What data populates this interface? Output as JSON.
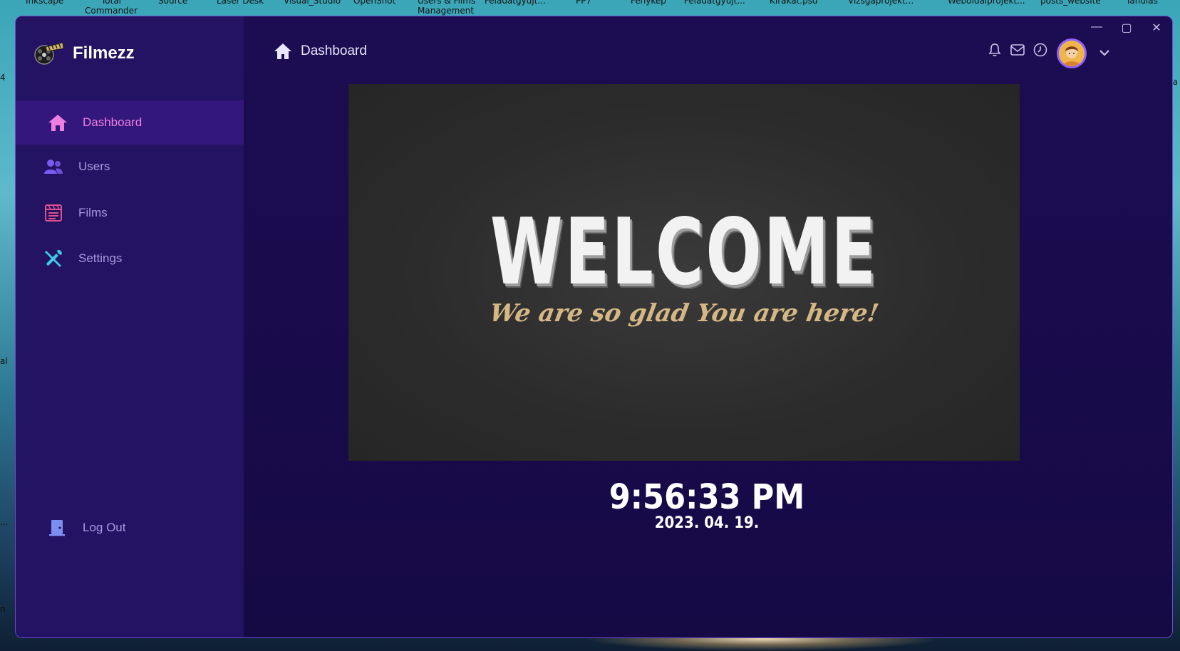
{
  "desktop": {
    "labels": [
      "Inkscape",
      "Total Commander",
      "Source",
      "Laser Desk",
      "Visual_Studio",
      "OpenShot",
      "Users & Films Management",
      "Feladatgyűjt...",
      "PP7",
      "Fénykép",
      "Feladatgyűjt...",
      "Kirakat.psd",
      "Vizsgaprojekt...",
      "Weboldalprojekt...",
      "posts_website",
      "Tanulás"
    ],
    "side": [
      "4",
      "al",
      "...",
      "n",
      "ga"
    ]
  },
  "window": {
    "controls": {
      "minimize": "—",
      "maximize": "▢",
      "close": "✕"
    }
  },
  "brand": {
    "name": "Filmezz"
  },
  "sidebar": {
    "items": [
      {
        "label": "Dashboard",
        "icon": "home-icon",
        "color": "#ee7fe1"
      },
      {
        "label": "Users",
        "icon": "users-icon",
        "color": "#7a5cf2"
      },
      {
        "label": "Films",
        "icon": "film-list-icon",
        "color": "#e0508d"
      },
      {
        "label": "Settings",
        "icon": "tools-icon",
        "color": "#3ec9e6"
      }
    ],
    "logout": {
      "label": "Log Out",
      "icon": "door-icon",
      "color": "#7c8ff0"
    }
  },
  "header": {
    "title": "Dashboard",
    "icons": [
      "bell-icon",
      "mail-icon",
      "clock-icon",
      "avatar",
      "chevron-down-icon"
    ]
  },
  "banner": {
    "title": "WELCOME",
    "subtitle": "We are so glad You are here!"
  },
  "clock": {
    "time": "9:56:33 PM",
    "date": "2023. 04. 19."
  },
  "colors": {
    "sidebar_bg": "#241262",
    "active_bg": "#34177d",
    "main_bg": "#1c0c52",
    "accent": "#ee7fe1",
    "border": "#6d4ad0"
  }
}
